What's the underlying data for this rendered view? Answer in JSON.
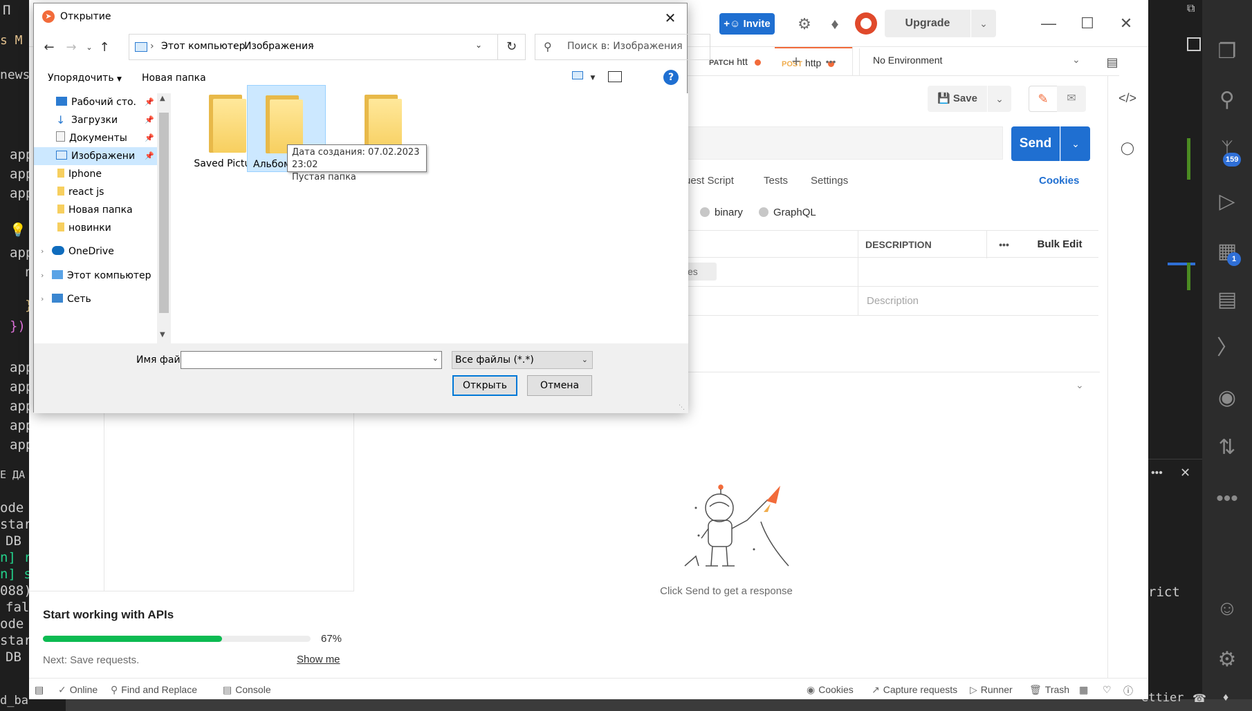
{
  "vscode": {
    "left_fragments": [
      "П",
      "s M",
      "news",
      "app",
      "app",
      "app",
      "app",
      "n",
      "}",
      "})",
      "app",
      "app",
      "app",
      "app",
      "app",
      "Е ДА",
      "ode",
      "star",
      "DB",
      "n] r",
      "n] s",
      "088)",
      "fal",
      "ode",
      "star",
      "DB"
    ],
    "status_left_text": "d_ba",
    "right_code_text": "rict",
    "activity": {
      "scm_badge": "159",
      "extensions_badge": "1"
    },
    "status_right": "ettier"
  },
  "postman": {
    "header": {
      "invite_label": "Invite",
      "upgrade_label": "Upgrade"
    },
    "tabs": [
      {
        "method": "PATCH",
        "label": "htt",
        "method_color": "#505050"
      },
      {
        "method": "POST",
        "label": "http",
        "method_color": "#f0ad4e"
      }
    ],
    "environment": "No Environment",
    "save_label": "Save",
    "send_label": "Send",
    "request_subtabs": [
      "uest Script",
      "Tests",
      "Settings"
    ],
    "cookies_label": "Cookies",
    "body_types": [
      "binary",
      "GraphQL"
    ],
    "kv_table": {
      "description_header": "DESCRIPTION",
      "more_label": "•••",
      "bulk_edit_label": "Bulk Edit",
      "auto_tag": "es",
      "description_placeholder": "Description"
    },
    "response_hint": "Click Send to get a response",
    "onboarding": {
      "title": "Start working with APIs",
      "progress_pct": "67%",
      "progress_fraction": 0.67,
      "next_text": "Next: Save requests.",
      "show_me_label": "Show me"
    },
    "status_bar": {
      "online": "Online",
      "find_replace": "Find and Replace",
      "console": "Console",
      "cookies": "Cookies",
      "capture": "Capture requests",
      "runner": "Runner",
      "trash": "Trash"
    }
  },
  "dialog": {
    "title": "Открытие",
    "breadcrumbs": [
      "Этот компьютер",
      "Изображения"
    ],
    "search_placeholder": "Поиск в: Изображения",
    "organize_label": "Упорядочить",
    "new_folder_label": "Новая папка",
    "nav_items": [
      {
        "label": "Рабочий сто.",
        "icon": "desktop-icon",
        "pinned": true
      },
      {
        "label": "Загрузки",
        "icon": "downloads-icon",
        "pinned": true
      },
      {
        "label": "Документы",
        "icon": "documents-icon",
        "pinned": true
      },
      {
        "label": "Изображени",
        "icon": "pictures-icon",
        "pinned": true,
        "selected": true
      },
      {
        "label": "Iphone",
        "icon": "folder-icon"
      },
      {
        "label": "react js",
        "icon": "folder-icon"
      },
      {
        "label": "Новая папка",
        "icon": "folder-icon"
      },
      {
        "label": "новинки",
        "icon": "folder-icon"
      },
      {
        "label": "OneDrive",
        "icon": "onedrive-icon",
        "expandable": true
      },
      {
        "label": "Этот компьютер",
        "icon": "computer-icon",
        "expandable": true
      },
      {
        "label": "Сеть",
        "icon": "network-icon",
        "expandable": true
      }
    ],
    "files": [
      {
        "label": "Saved Pictures"
      },
      {
        "label": "Альбом",
        "selected": true
      },
      {
        "label": ""
      }
    ],
    "tooltip": {
      "line1": "Дата создания: 07.02.2023 23:02",
      "line2": "Пустая папка"
    },
    "file_name_label": "Имя файла:",
    "file_name_value": "",
    "filter_value": "Все файлы (*.*)",
    "open_label": "Открыть",
    "cancel_label": "Отмена"
  }
}
